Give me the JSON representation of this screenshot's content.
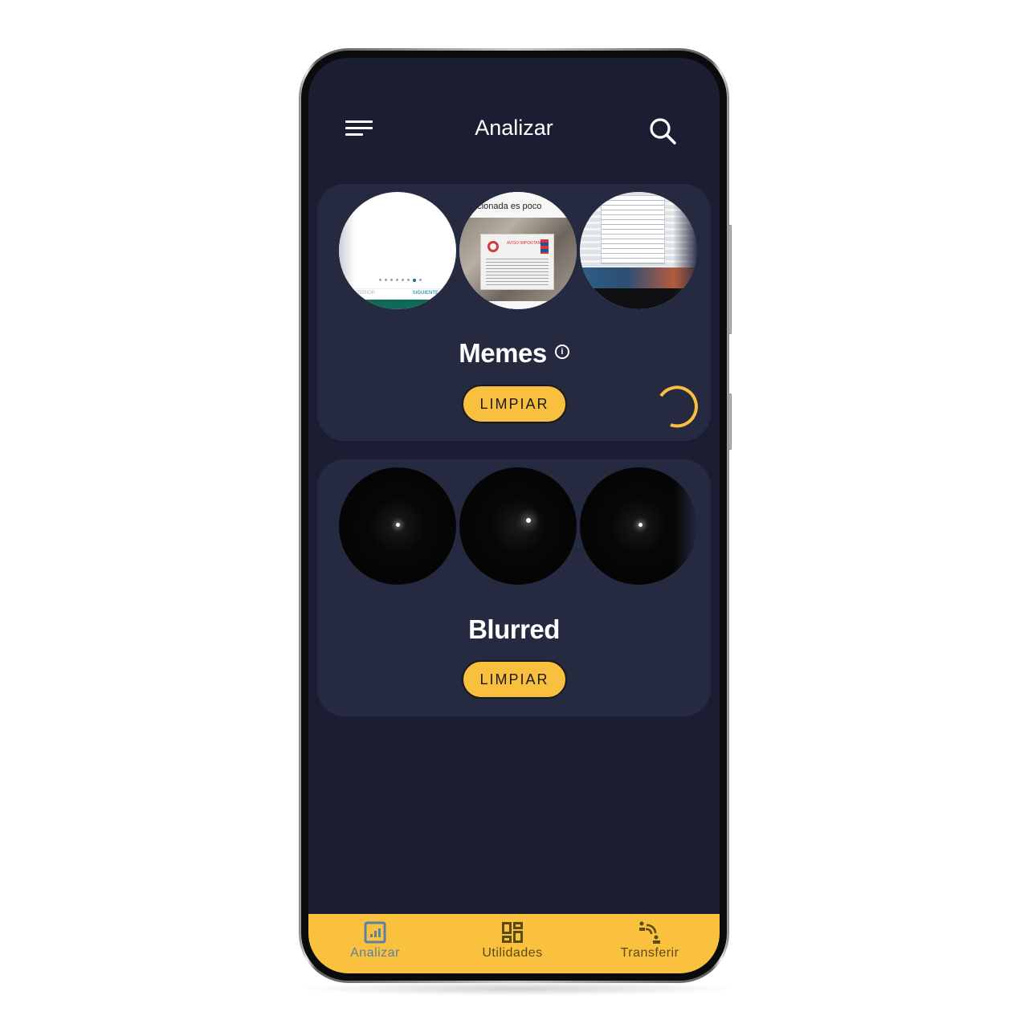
{
  "header": {
    "title": "Analizar",
    "menu_icon": "menu-icon",
    "search_icon": "search-icon"
  },
  "cards": [
    {
      "title": "Memes",
      "has_info": true,
      "info_glyph": "i",
      "action_label": "LIMPIAR",
      "loading": true,
      "thumbnails": [
        {
          "description": "white app onboarding screenshot",
          "prev_text": "ANTERIOR",
          "next_text": "SIGUIENTE"
        },
        {
          "description": "photo of notice sign",
          "caption": "epcionada es poco",
          "sign_text": "AVISO IMPORTANTE"
        },
        {
          "description": "photo of computer screen"
        }
      ]
    },
    {
      "title": "Blurred",
      "has_info": false,
      "action_label": "LIMPIAR",
      "loading": false,
      "thumbnails": [
        {
          "description": "dark photo with small light point"
        },
        {
          "description": "dark photo with small light point"
        },
        {
          "description": "dark photo with small light point"
        }
      ]
    }
  ],
  "bottom_nav": {
    "items": [
      {
        "label": "Analizar",
        "icon": "chart-icon",
        "active": true
      },
      {
        "label": "Utilidades",
        "icon": "dashboard-icon",
        "active": false
      },
      {
        "label": "Transferir",
        "icon": "transfer-icon",
        "active": false
      }
    ]
  },
  "colors": {
    "background": "#1b1e33",
    "card": "#262a40",
    "accent": "#f8c03e",
    "nav_active": "#5a7fa8",
    "nav_inactive": "#5b4a14",
    "text": "#ffffff"
  }
}
